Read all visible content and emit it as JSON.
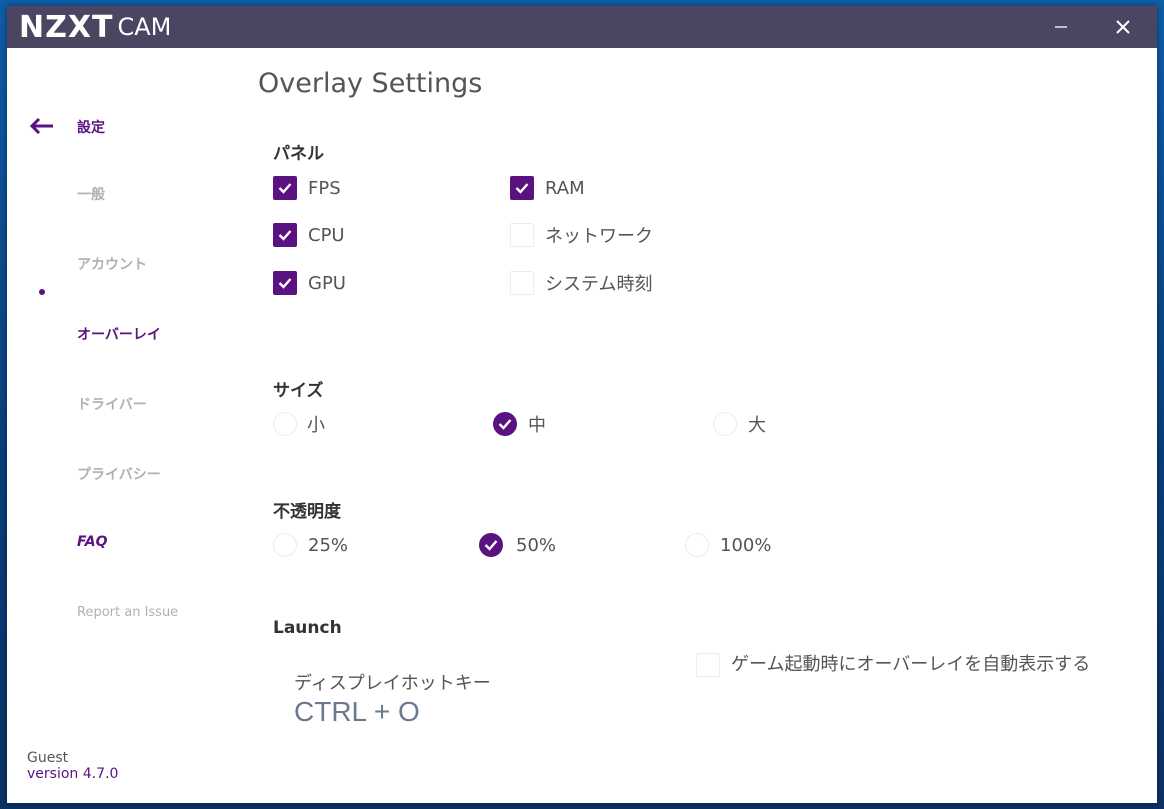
{
  "titlebar": {
    "brand": "NZXT",
    "product": "CAM",
    "minimize_icon": "minimize-icon",
    "close_icon": "close-icon"
  },
  "sidebar": {
    "back_icon": "arrow-left-icon",
    "header_label": "設定",
    "items": [
      {
        "label": "一般",
        "active": false
      },
      {
        "label": "アカウント",
        "active": false
      },
      {
        "label": "オーバーレイ",
        "active": true
      },
      {
        "label": "ドライバー",
        "active": false
      },
      {
        "label": "プライバシー",
        "active": false
      },
      {
        "label": "FAQ",
        "active": false
      },
      {
        "label": "Report an Issue",
        "active": false
      }
    ],
    "user": "Guest",
    "version": "version 4.7.0"
  },
  "main": {
    "title": "Overlay Settings",
    "panel": {
      "title": "パネル",
      "options": [
        {
          "label": "FPS",
          "checked": true
        },
        {
          "label": "CPU",
          "checked": true
        },
        {
          "label": "GPU",
          "checked": true
        },
        {
          "label": "RAM",
          "checked": true
        },
        {
          "label": "ネットワーク",
          "checked": false
        },
        {
          "label": "システム時刻",
          "checked": false
        }
      ]
    },
    "size": {
      "title": "サイズ",
      "options": [
        {
          "label": "小",
          "selected": false
        },
        {
          "label": "中",
          "selected": true
        },
        {
          "label": "大",
          "selected": false
        }
      ]
    },
    "opacity": {
      "title": "不透明度",
      "options": [
        {
          "label": "25%",
          "selected": false
        },
        {
          "label": "50%",
          "selected": true
        },
        {
          "label": "100%",
          "selected": false
        }
      ]
    },
    "launch": {
      "title": "Launch",
      "hotkey_label": "ディスプレイホットキー",
      "hotkey_value": "CTRL + O",
      "auto_launch_label": "ゲーム起動時にオーバーレイを自動表示する",
      "auto_launch_checked": false
    }
  },
  "colors": {
    "accent": "#5a1280",
    "titlebar": "#4a4560",
    "desktop": "#0f5ea8"
  }
}
